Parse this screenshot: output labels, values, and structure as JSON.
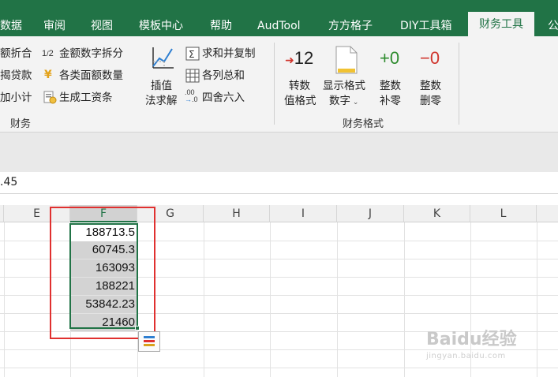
{
  "tabs": [
    {
      "label": "数据",
      "active": false
    },
    {
      "label": "审阅",
      "active": false
    },
    {
      "label": "视图",
      "active": false
    },
    {
      "label": "模板中心",
      "active": false
    },
    {
      "label": "帮助",
      "active": false
    },
    {
      "label": "AudTool",
      "active": false
    },
    {
      "label": "方方格子",
      "active": false
    },
    {
      "label": "DIY工具箱",
      "active": false
    },
    {
      "label": "财务工具",
      "active": true
    },
    {
      "label": "公",
      "active": false
    }
  ],
  "ribbon": {
    "finance_group": {
      "label": "财务",
      "col1": [
        "额折合",
        "揭贷款",
        "加小计"
      ],
      "col2": [
        "金额数字拆分",
        "各类面额数量",
        "生成工资条"
      ],
      "interp": {
        "line1": "插值",
        "line2": "法求解"
      },
      "col4": [
        "求和并复制",
        "各列总和",
        "四舍六入"
      ]
    },
    "format_group": {
      "label": "财务格式",
      "convert": {
        "icon_text": "12",
        "line1": "转数",
        "line2": "值格式"
      },
      "display": {
        "line1": "显示格式",
        "line2": "数字"
      },
      "pad": {
        "icon_text": "+0",
        "line1": "整数",
        "line2": "补零"
      },
      "trim": {
        "icon_text": "−0",
        "line1": "整数",
        "line2": "删零"
      }
    }
  },
  "formula_bar": {
    "value": ".45"
  },
  "columns": [
    "E",
    "F",
    "G",
    "H",
    "I",
    "J",
    "K",
    "L"
  ],
  "selected_column": "F",
  "cells": [
    "188713.5",
    "60745.3",
    "163093",
    "188221",
    "53842.23",
    "21460"
  ],
  "watermark": {
    "brand": "Baidu经验",
    "url": "jingyan.baidu.com"
  },
  "colors": {
    "excel_green": "#217346",
    "highlight_red": "#e0302f",
    "selection_gray": "#d3d3d3"
  }
}
